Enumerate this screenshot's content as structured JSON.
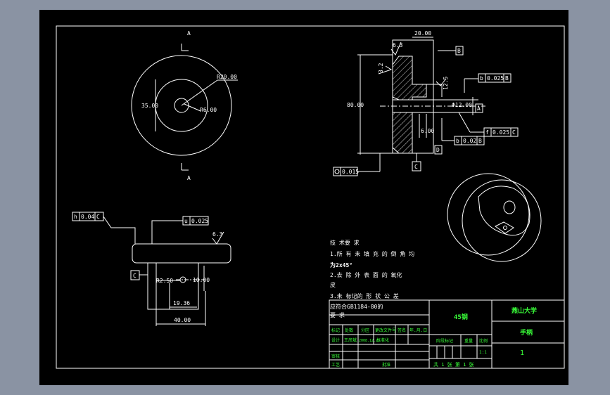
{
  "colors": {
    "canvas": "#000000",
    "line": "#ffffff",
    "title_text": "#39ff39",
    "border": "#8a93a3"
  },
  "front_view": {
    "section_mark_top": "A",
    "section_mark_bottom": "A",
    "dim_r20": "R20.00",
    "dim_35": "35.00",
    "dim_r6": "R6.00"
  },
  "section_view": {
    "dim_20": "20.00",
    "dim_80": "80.00",
    "dim_dia12": "Φ12.00",
    "dim_6": "6.00",
    "datum_b": "B",
    "datum_a": "A",
    "datum_c": "C",
    "datum_d": "D",
    "rough_63": "6.3",
    "rough_32": "3.2",
    "rough_125": "12.5",
    "tol_b_val": "0.025",
    "tol_b_ref": "B",
    "tol_f_val": "0.025",
    "tol_f_ref": "C",
    "tol_mid_val": "0.02",
    "tol_mid_ref": "B",
    "tol_bottom_val": "0.015"
  },
  "top_view": {
    "tol_left_val": "0.04",
    "tol_left_ref": "C",
    "tol_right_val": "0.025",
    "rough": "6.3",
    "datum_c": "C",
    "dim_r25": "R2.50",
    "dim_10": "10.00",
    "dim_1936": "19.36",
    "dim_40": "40.00"
  },
  "tech_notes": [
    "技 术要 求",
    "1.所 有 未 填 充 的 倒 角 均",
    "为2x45°",
    "2.去 除 外 表 面 的 氧化",
    "皮",
    "3.未 标记的 形 状 公 差",
    "应符合GB1184-80的",
    "要 求"
  ],
  "title_block": {
    "material": "45钢",
    "university": "燕山大学",
    "part_name": "手柄",
    "drawing_no": "1",
    "stage_label": "阶段标记",
    "weight_label": "重量",
    "scale_label": "比例",
    "scale_value": "1:1",
    "sheet_info": "共 1 张    第 1 张",
    "headers": [
      "标记",
      "处数",
      "分区",
      "更改文件号",
      "签名",
      "年.月.日"
    ],
    "designer_label": "设计",
    "designer_name": "王彦斌",
    "design_date": "2008.12.23",
    "standardize_label": "标准化",
    "review_label": "审核",
    "process_label": "工艺",
    "approve_label": "批准"
  }
}
